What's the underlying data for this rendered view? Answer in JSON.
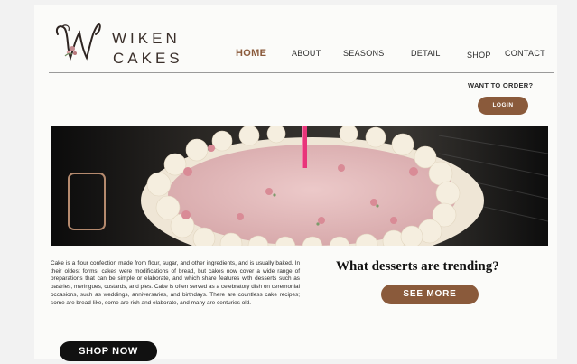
{
  "brand": {
    "name_line1": "WIKEN",
    "name_line2": "CAKES",
    "logo_icon": "cursive-w-monogram-icon"
  },
  "nav": {
    "items": [
      "HOME",
      "ABOUT",
      "SEASONS",
      "DETAIL",
      "SHOP",
      "CONTACT"
    ],
    "active": "HOME"
  },
  "order": {
    "prompt": "WANT TO ORDER?",
    "login_label": "LOGIN"
  },
  "hero": {
    "image_subject": "pink-birthday-cake-with-candle"
  },
  "content": {
    "description": "Cake is a flour confection made from flour, sugar, and other ingredients, and is usually baked. In their oldest forms, cakes were modifications of bread, but cakes now cover a wide range of preparations that can be simple or elaborate, and which share features with desserts such as pastries, meringues, custards, and pies. Cake is often served as a celebratory dish on ceremonial occasions, such as weddings, anniversaries, and birthdays. There are countless cake recipes; some are bread-like, some are rich and elaborate, and many are centuries old.",
    "trending_heading": "What desserts are trending?",
    "see_more_label": "SEE MORE",
    "shop_now_label": "SHOP NOW"
  },
  "colors": {
    "accent": "#8a5a3b",
    "dark": "#111111",
    "background": "#fbfbf9"
  }
}
